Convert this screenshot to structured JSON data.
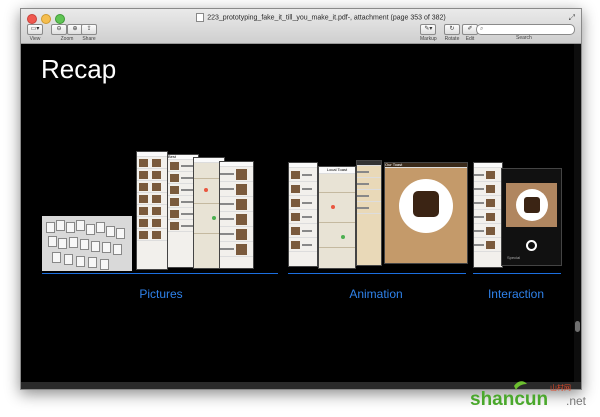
{
  "window": {
    "title": "223_prototyping_fake_it_till_you_make_it.pdf-, attachment (page 353 of 382)"
  },
  "toolbar": {
    "view_label": "View",
    "zoom_label": "Zoom",
    "share_label": "Share",
    "markup_label": "Markup",
    "rotate_label": "Rotate",
    "edit_label": "Edit",
    "search_label": "Search"
  },
  "slide": {
    "title": "Recap",
    "categories": [
      {
        "label": "Pictures"
      },
      {
        "label": "Animation"
      },
      {
        "label": "Interaction"
      }
    ],
    "mockups": {
      "list_title": "Best",
      "map_title": "Local Toast",
      "photo_title": "Our Toast",
      "camera_caption": "Special"
    }
  },
  "watermark": {
    "text": "shancun",
    "suffix": ".net",
    "cjk": "山村网"
  },
  "colors": {
    "accent": "#2f82ea",
    "divider": "#1c6fe0",
    "slide_bg": "#000000"
  }
}
